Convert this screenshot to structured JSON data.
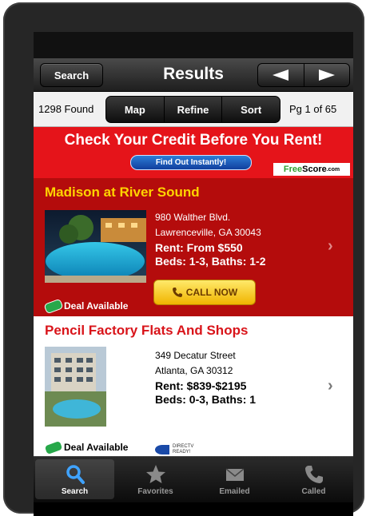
{
  "nav": {
    "back_label": "Search",
    "title": "Results",
    "prev_icon": "triangle-left-icon",
    "next_icon": "triangle-right-icon"
  },
  "toolbar": {
    "found": "1298 Found",
    "map": "Map",
    "refine": "Refine",
    "sort": "Sort",
    "page": "Pg 1 of 65"
  },
  "banner": {
    "title": "Check Your Credit Before You Rent!",
    "button": "Find Out Instantly!",
    "logo_prefix": "Free",
    "logo_main": "Score",
    "logo_suffix": ".com",
    "color": "#e5141a"
  },
  "listings": [
    {
      "name": "Madison at River Sound",
      "address1": "980 Walther Blvd.",
      "address2": "Lawrenceville, GA 30043",
      "rent": "Rent: From $550",
      "beds": "Beds: 1-3, Baths: 1-2",
      "call": "CALL NOW",
      "deal": "Deal Available"
    },
    {
      "name": "Pencil Factory Flats And Shops",
      "address1": "349 Decatur Street",
      "address2": "Atlanta, GA 30312",
      "rent": "Rent: $839-$2195",
      "beds": "Beds: 0-3, Baths: 1",
      "badge1": "DIRECTV",
      "badge2": "READY!",
      "deal": "Deal Available"
    }
  ],
  "tabs": [
    {
      "label": "Search",
      "icon": "search-icon",
      "active": true
    },
    {
      "label": "Favorites",
      "icon": "star-icon"
    },
    {
      "label": "Emailed",
      "icon": "envelope-icon"
    },
    {
      "label": "Called",
      "icon": "phone-icon"
    }
  ]
}
